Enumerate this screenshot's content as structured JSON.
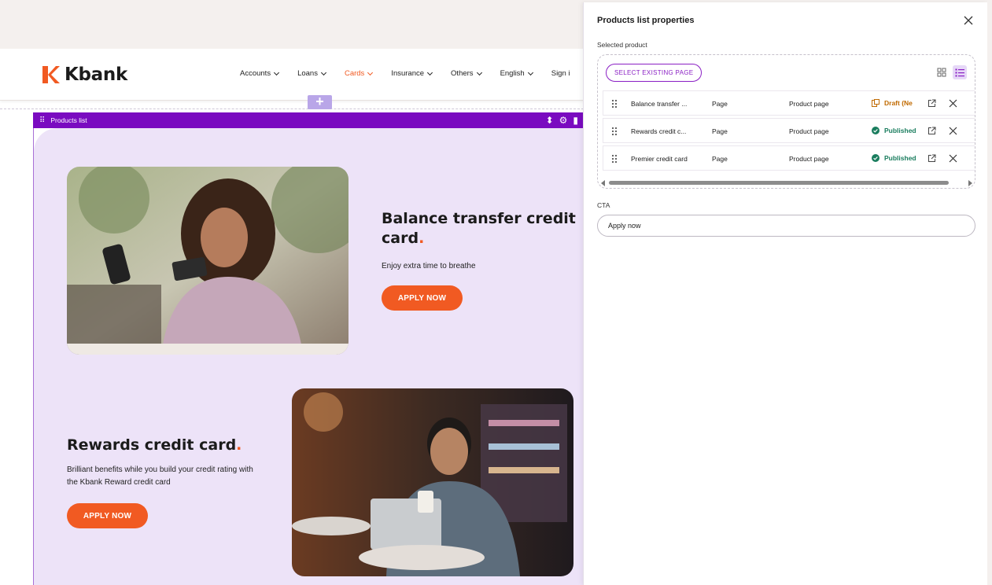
{
  "site": {
    "logo_text": "Kbank",
    "nav": [
      {
        "label": "Accounts",
        "active": false
      },
      {
        "label": "Loans",
        "active": false
      },
      {
        "label": "Cards",
        "active": true
      },
      {
        "label": "Insurance",
        "active": false
      },
      {
        "label": "Others",
        "active": false
      },
      {
        "label": "English",
        "active": false
      },
      {
        "label": "Sign i",
        "active": false
      }
    ]
  },
  "component": {
    "label": "Products list"
  },
  "cards": [
    {
      "title": "Balance transfer credit card",
      "dot": ".",
      "description": "Enjoy extra time to breathe",
      "cta": "APPLY NOW"
    },
    {
      "title": "Rewards credit card",
      "dot": ".",
      "description": "Brilliant benefits while you build your credit rating with the Kbank Reward credit card",
      "cta": "APPLY NOW"
    }
  ],
  "panel": {
    "title": "Products list properties",
    "selected_label": "Selected product",
    "select_button": "SELECT EXISTING PAGE",
    "rows": [
      {
        "name": "Balance transfer ...",
        "type": "Page",
        "template": "Product page",
        "status": "Draft (Ne"
      },
      {
        "name": "Rewards credit c...",
        "type": "Page",
        "template": "Product page",
        "status": "Published"
      },
      {
        "name": "Premier credit card",
        "type": "Page",
        "template": "Product page",
        "status": "Published"
      }
    ],
    "cta_label": "CTA",
    "cta_value": "Apply now"
  },
  "colors": {
    "brand_orange": "#f15a22",
    "component_purple": "#7a0bc0",
    "published_green": "#1a7d5e",
    "draft_orange": "#c06a00"
  }
}
